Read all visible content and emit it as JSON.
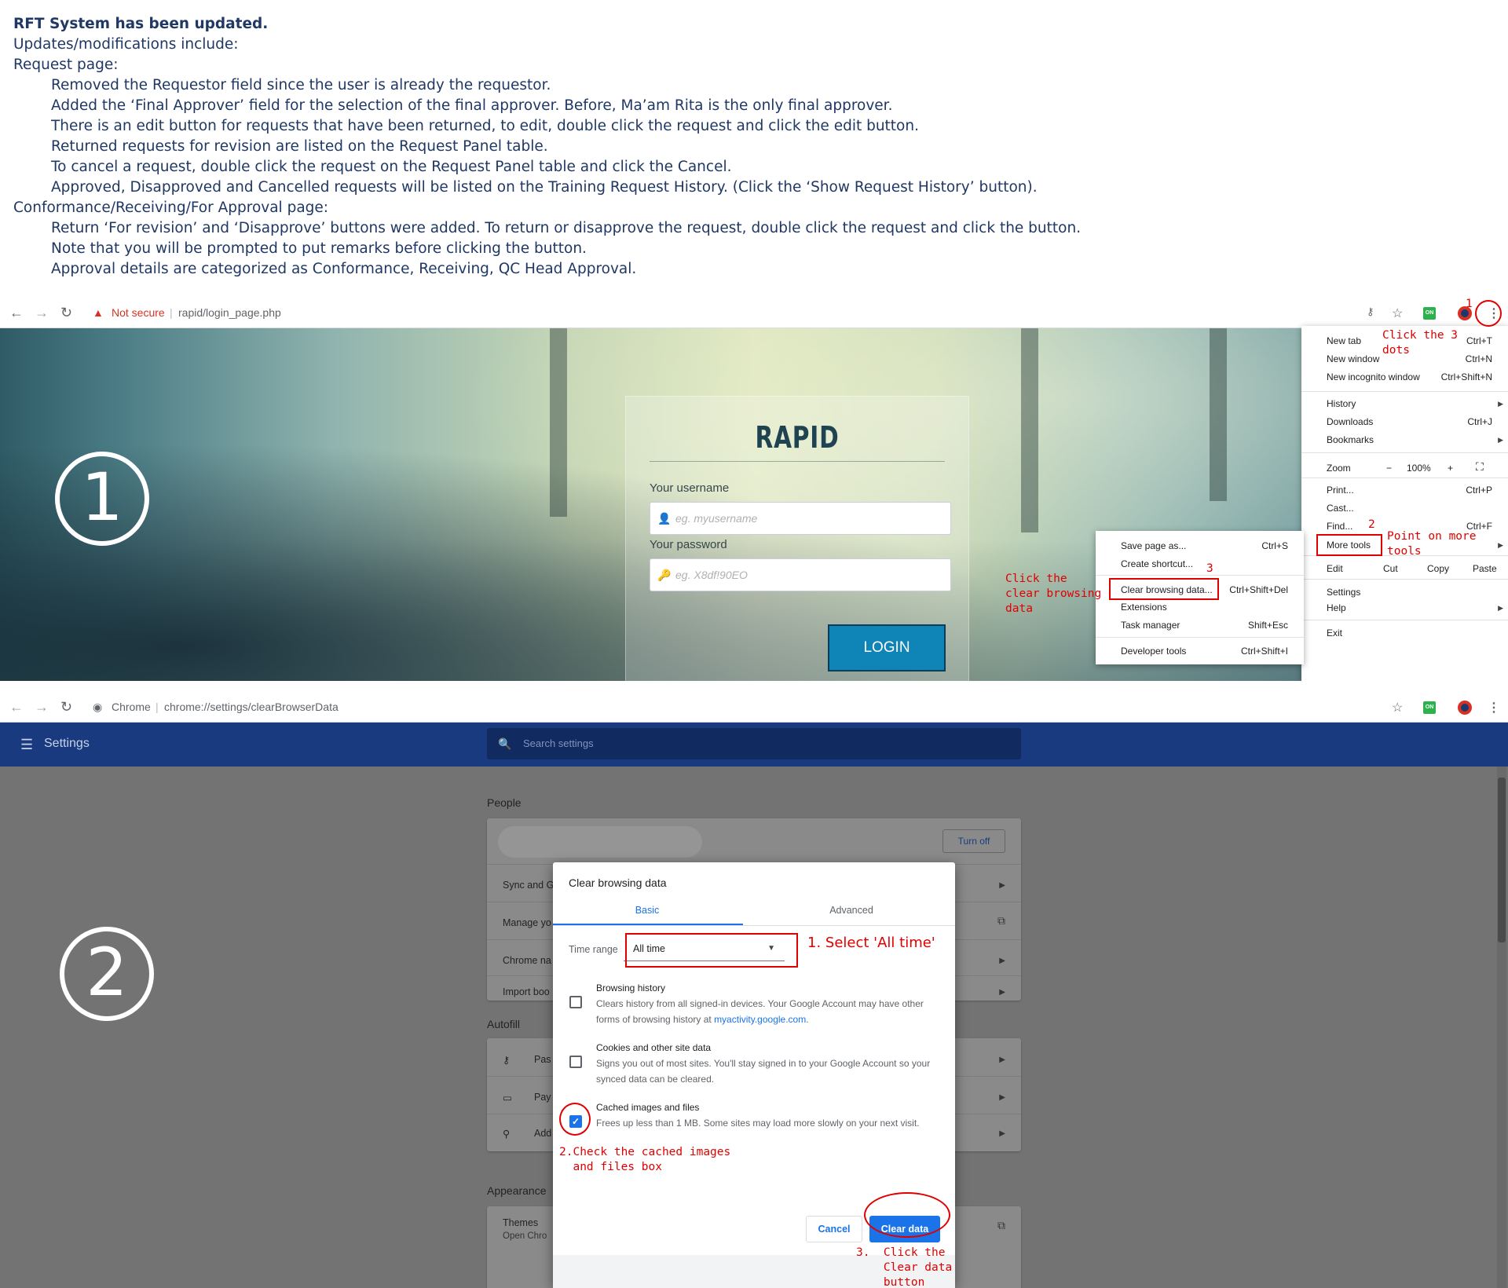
{
  "notes": {
    "title": "RFT System has been updated.",
    "intro": "Updates/modifications include:",
    "section1": "Request page:",
    "section1_items": [
      "Removed the Requestor field since the user is already the requestor.",
      "Added the ‘Final Approver’ field for the selection of the final approver. Before, Ma’am Rita is the only final approver.",
      "There is an edit button for requests that have been returned, to edit, double click the request and click the edit button.",
      "Returned requests for revision are listed on the Request Panel table.",
      "To cancel a request, double click the request on the Request Panel table and click the Cancel.",
      "Approved, Disapproved and Cancelled requests will be listed on the Training Request History. (Click the ‘Show Request History’ button)."
    ],
    "section2": "Conformance/Receiving/For Approval page:",
    "section2_items": [
      "Return ‘For revision’ and ‘Disapprove’ buttons were added. To return or disapprove the request, double click the request and click the button.",
      "Note that you will be prompted to put remarks before clicking the button.",
      "Approval details are categorized as Conformance, Receiving, QC Head Approval."
    ]
  },
  "shot1": {
    "step_number": "1",
    "security_label": "Not secure",
    "url": "rapid/login_page.php",
    "login": {
      "brand": "RAPID",
      "username_label": "Your username",
      "username_placeholder": "eg. myusername",
      "password_label": "Your password",
      "password_placeholder": "eg. X8df!90EO",
      "button": "LOGIN"
    },
    "menu": {
      "new_tab": "New tab",
      "new_tab_key": "Ctrl+T",
      "new_window": "New window",
      "new_window_key": "Ctrl+N",
      "incognito": "New incognito window",
      "incognito_key": "Ctrl+Shift+N",
      "history": "History",
      "downloads": "Downloads",
      "downloads_key": "Ctrl+J",
      "bookmarks": "Bookmarks",
      "zoom": "Zoom",
      "zoom_minus": "−",
      "zoom_value": "100%",
      "zoom_plus": "+",
      "print": "Print...",
      "print_key": "Ctrl+P",
      "cast": "Cast...",
      "find": "Find...",
      "find_key": "Ctrl+F",
      "more_tools": "More tools",
      "edit": "Edit",
      "cut": "Cut",
      "copy": "Copy",
      "paste": "Paste",
      "settings": "Settings",
      "help": "Help",
      "exit": "Exit"
    },
    "submenu": {
      "save_page": "Save page as...",
      "save_page_key": "Ctrl+S",
      "create_shortcut": "Create shortcut...",
      "clear_browsing": "Clear browsing data...",
      "clear_browsing_key": "Ctrl+Shift+Del",
      "extensions": "Extensions",
      "task_manager": "Task manager",
      "task_manager_key": "Shift+Esc",
      "developer_tools": "Developer tools",
      "developer_tools_key": "Ctrl+Shift+I"
    },
    "annotations": {
      "n1": "1",
      "dots": "Click the 3\ndots",
      "n2": "2",
      "more_tools": "Point on more\ntools",
      "n3": "3",
      "clear": "Click the\nclear browsing\ndata"
    }
  },
  "shot2": {
    "step_number": "2",
    "site_label": "Chrome",
    "url": "chrome://settings/clearBrowserData",
    "header_title": "Settings",
    "search_placeholder": "Search settings",
    "people_title": "People",
    "turn_off": "Turn off",
    "people_rows": [
      "Sync and G",
      "Manage yo",
      "Chrome na",
      "Import boo"
    ],
    "autofill_title": "Autofill",
    "autofill_rows": [
      "Pas",
      "Pay",
      "Add"
    ],
    "appearance_title": "Appearance",
    "themes": "Themes",
    "themes_sub": "Open Chro",
    "dialog": {
      "title": "Clear browsing data",
      "tab_basic": "Basic",
      "tab_advanced": "Advanced",
      "time_range_label": "Time range",
      "time_range_value": "All time",
      "opt1_title": "Browsing history",
      "opt1_desc": "Clears history from all signed-in devices. Your Google Account may have other forms of browsing history at",
      "opt1_link": "myactivity.google.com",
      "opt1_end": ".",
      "opt2_title": "Cookies and other site data",
      "opt2_desc": "Signs you out of most sites. You'll stay signed in to your Google Account so your synced data can be cleared.",
      "opt3_title": "Cached images and files",
      "opt3_desc": "Frees up less than 1 MB. Some sites may load more slowly on your next visit.",
      "cancel": "Cancel",
      "clear": "Clear data"
    },
    "annotations": {
      "select": "1. Select 'All time'",
      "check": "2.Check the cached images\n  and files box",
      "clear": "3.  Click the\n    Clear data\n    button"
    }
  },
  "colors": {
    "notes_text": "#1f3864",
    "annotation": "#e00000",
    "settings_header": "#1a3a80",
    "accent": "#1a73e8"
  }
}
